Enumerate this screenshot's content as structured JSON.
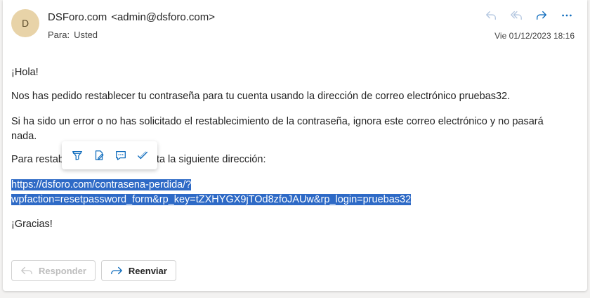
{
  "sender": {
    "initial": "D",
    "name": "DSForo.com",
    "email": "<admin@dsforo.com>"
  },
  "to": {
    "label": "Para:",
    "value": "Usted"
  },
  "date": "Vie 01/12/2023 18:16",
  "header_actions": [
    "reply-icon",
    "reply-all-icon",
    "forward-icon",
    "more-icon"
  ],
  "body": {
    "greeting": "¡Hola!",
    "p1": "Nos has pedido restablecer tu contraseña para tu cuenta usando la dirección de correo electrónico pruebas32.",
    "p2": "Si ha sido un error o no has solicitado el restablecimiento de la contraseña, ignora este correo electrónico y no pasará nada.",
    "p3_start": "Para restab",
    "p3_end": "visita la siguiente dirección:",
    "link_line1": "https://dsforo.com/contrasena-perdida/?",
    "link_line2": "wpfaction=resetpassword_form&rp_key=tZXHYGX9jTOd8zfoJAUw&rp_login=pruebas32",
    "thanks": "¡Gracias!"
  },
  "floating_toolbar": [
    "highlight-icon",
    "note-icon",
    "comment-icon",
    "check-icon"
  ],
  "reply_buttons": {
    "reply_label": "Responder",
    "forward_label": "Reenviar"
  },
  "colors": {
    "accent": "#2e6ac6",
    "icon_blue": "#0f6cbd",
    "avatar_bg": "#e8d3a8"
  }
}
